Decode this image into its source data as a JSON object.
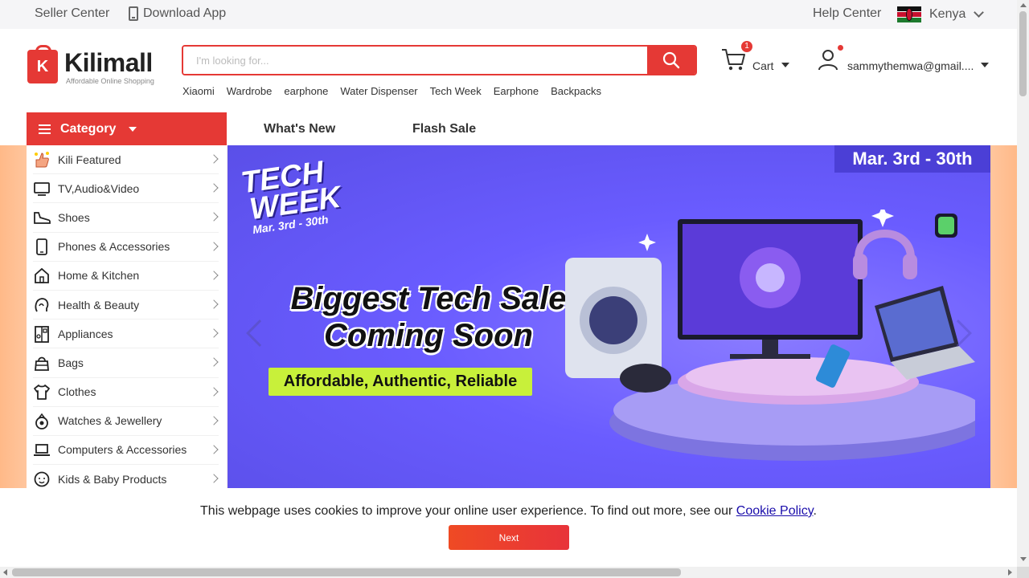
{
  "topbar": {
    "seller_center": "Seller Center",
    "download_app": "Download App",
    "help_center": "Help Center",
    "country": "Kenya"
  },
  "header": {
    "logo_name": "Kilimall",
    "logo_tagline": "Affordable Online Shopping",
    "search_placeholder": "I'm looking for...",
    "hot_words": [
      "Xiaomi",
      "Wardrobe",
      "earphone",
      "Water Dispenser",
      "Tech Week",
      "Earphone",
      "Backpacks"
    ],
    "cart_label": "Cart",
    "cart_count": "1",
    "account_email": "sammythemwa@gmail...."
  },
  "nav": {
    "category_label": "Category",
    "links": [
      "What's New",
      "Flash Sale"
    ]
  },
  "categories": [
    {
      "label": "Kili Featured",
      "icon": "thumbs-up-icon"
    },
    {
      "label": "TV,Audio&Video",
      "icon": "tv-icon"
    },
    {
      "label": "Shoes",
      "icon": "shoe-icon"
    },
    {
      "label": "Phones & Accessories",
      "icon": "phone-icon"
    },
    {
      "label": "Home & Kitchen",
      "icon": "home-icon"
    },
    {
      "label": "Health & Beauty",
      "icon": "face-icon"
    },
    {
      "label": "Appliances",
      "icon": "fridge-icon"
    },
    {
      "label": "Bags",
      "icon": "bag-icon"
    },
    {
      "label": "Clothes",
      "icon": "shirt-icon"
    },
    {
      "label": "Watches & Jewellery",
      "icon": "ring-icon"
    },
    {
      "label": "Computers & Accessories",
      "icon": "laptop-icon"
    },
    {
      "label": "Kids & Baby Products",
      "icon": "baby-icon"
    }
  ],
  "banner": {
    "date_tag": "Mar. 3rd - 30th",
    "logo_line1": "TECH",
    "logo_line2": "WEEK",
    "logo_date": "Mar. 3rd - 30th",
    "headline_1": "Biggest Tech Sale",
    "headline_2": "Coming Soon",
    "subline": "Affordable, Authentic, Reliable"
  },
  "cookie": {
    "text": "This webpage uses cookies to improve your online user experience. To find out more, see our ",
    "link": "Cookie Policy",
    "end": ".",
    "button": "Next"
  },
  "colors": {
    "brand": "#e53935",
    "banner": "#6a5cff",
    "pill": "#c8f03a"
  }
}
